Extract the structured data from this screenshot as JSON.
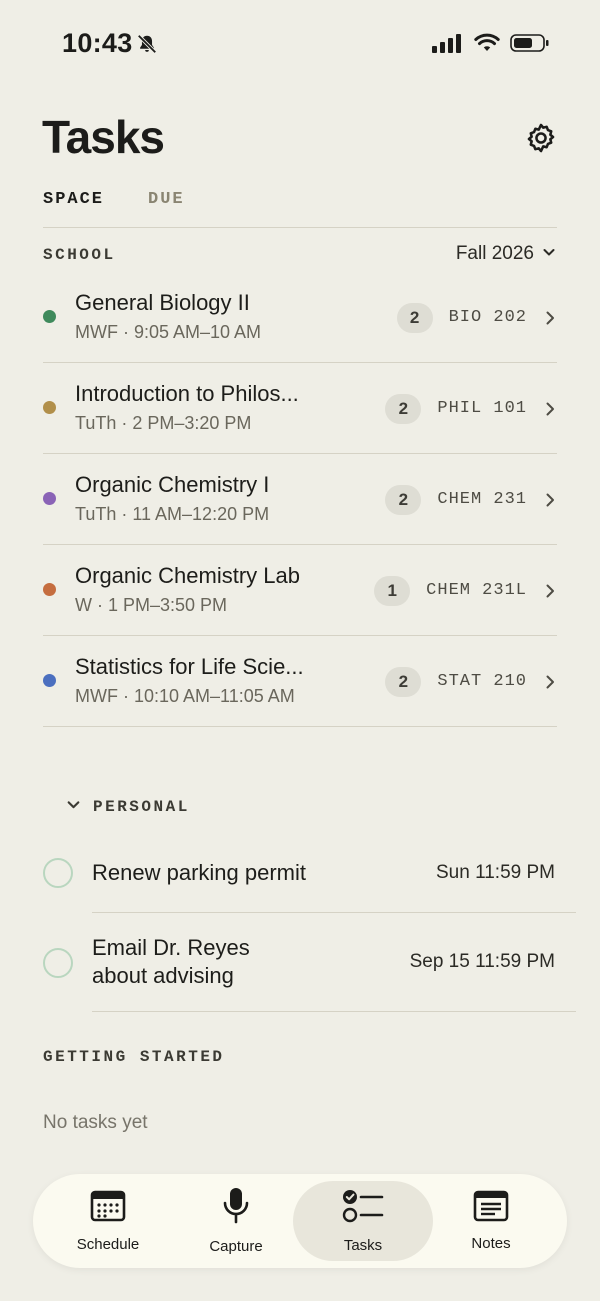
{
  "status_bar": {
    "time": "10:43"
  },
  "header": {
    "title": "Tasks"
  },
  "segments": {
    "space": "SPACE",
    "due": "DUE"
  },
  "school": {
    "label": "SCHOOL",
    "term": "Fall 2026",
    "courses": [
      {
        "name": "General Biology II",
        "schedule": "MWF · 9:05 AM–10 AM",
        "count": "2",
        "code": "BIO 202",
        "color": "#3f8a5c"
      },
      {
        "name": "Introduction to Philos...",
        "schedule": "TuTh · 2 PM–3:20 PM",
        "count": "2",
        "code": "PHIL 101",
        "color": "#b18f4a"
      },
      {
        "name": "Organic Chemistry I",
        "schedule": "TuTh · 11 AM–12:20 PM",
        "count": "2",
        "code": "CHEM 231",
        "color": "#8a63b6"
      },
      {
        "name": "Organic Chemistry Lab",
        "schedule": "W · 1 PM–3:50 PM",
        "count": "1",
        "code": "CHEM 231L",
        "color": "#c56d3f"
      },
      {
        "name": "Statistics for Life Scie...",
        "schedule": "MWF · 10:10 AM–11:05 AM",
        "count": "2",
        "code": "STAT 210",
        "color": "#4b6fbf"
      }
    ]
  },
  "personal": {
    "label": "PERSONAL",
    "tasks": [
      {
        "title": "Renew parking permit",
        "due": "Sun 11:59 PM"
      },
      {
        "title_line1": "Email Dr. Reyes",
        "title_line2": "about advising",
        "due": "Sep 15 11:59 PM"
      }
    ]
  },
  "getting_started": {
    "label": "GETTING STARTED",
    "empty": "No tasks yet"
  },
  "tabbar": {
    "schedule": "Schedule",
    "capture": "Capture",
    "tasks": "Tasks",
    "notes": "Notes",
    "active": "tasks"
  }
}
